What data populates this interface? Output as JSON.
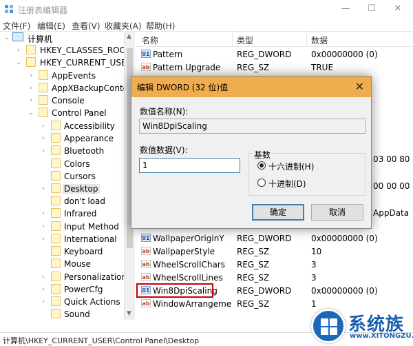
{
  "window": {
    "title": "注册表编辑器",
    "minimize": "—",
    "maximize": "☐",
    "close": "✕"
  },
  "menu": [
    "文件(F)",
    "编辑(E)",
    "查看(V)",
    "收藏夹(A)",
    "帮助(H)"
  ],
  "tree": {
    "root": "计算机",
    "items": [
      {
        "label": "HKEY_CLASSES_ROOT",
        "expander": "›"
      },
      {
        "label": "HKEY_CURRENT_USER",
        "expander": "⌄"
      },
      {
        "label": "AppEvents",
        "expander": "›"
      },
      {
        "label": "AppXBackupConter",
        "expander": "›"
      },
      {
        "label": "Console",
        "expander": "›"
      },
      {
        "label": "Control Panel",
        "expander": "⌄"
      },
      {
        "label": "Accessibility",
        "expander": "›"
      },
      {
        "label": "Appearance",
        "expander": "›"
      },
      {
        "label": "Bluetooth",
        "expander": "›"
      },
      {
        "label": "Colors",
        "expander": ""
      },
      {
        "label": "Cursors",
        "expander": ""
      },
      {
        "label": "Desktop",
        "expander": "›"
      },
      {
        "label": "don't load",
        "expander": ""
      },
      {
        "label": "Infrared",
        "expander": "›"
      },
      {
        "label": "Input Method",
        "expander": "›"
      },
      {
        "label": "International",
        "expander": "›"
      },
      {
        "label": "Keyboard",
        "expander": ""
      },
      {
        "label": "Mouse",
        "expander": ""
      },
      {
        "label": "Personalization",
        "expander": "›"
      },
      {
        "label": "PowerCfg",
        "expander": "›"
      },
      {
        "label": "Quick Actions",
        "expander": "›"
      },
      {
        "label": "Sound",
        "expander": ""
      }
    ]
  },
  "list": {
    "headers": {
      "name": "名称",
      "type": "类型",
      "data": "数据"
    },
    "rows": [
      {
        "icon": "dword",
        "name": "Pattern",
        "type": "REG_DWORD",
        "data": "0x00000000 (0)"
      },
      {
        "icon": "sz",
        "name": "Pattern Upgrade",
        "type": "REG_SZ",
        "data": "TRUE"
      },
      {
        "icon": "dword",
        "name": "WallpaperOriginY",
        "type": "REG_DWORD",
        "data": "0x00000000 (0)"
      },
      {
        "icon": "sz",
        "name": "WallpaperStyle",
        "type": "REG_SZ",
        "data": "10"
      },
      {
        "icon": "sz",
        "name": "WheelScrollChars",
        "type": "REG_SZ",
        "data": "3"
      },
      {
        "icon": "sz",
        "name": "WheelScrollLines",
        "type": "REG_SZ",
        "data": "3"
      },
      {
        "icon": "dword",
        "name": "Win8DpiScaling",
        "type": "REG_DWORD",
        "data": "0x00000000 (0)"
      },
      {
        "icon": "sz",
        "name": "WindowArrangeme...",
        "type": "REG_SZ",
        "data": "1"
      }
    ],
    "peek": {
      "a": "03 00 80",
      "b": "00 00 00",
      "c": "AppData"
    }
  },
  "dialog": {
    "title": "编辑 DWORD (32 位)值",
    "close": "✕",
    "name_label": "数值名称(N):",
    "name_value": "Win8DpiScaling",
    "data_label": "数值数据(V):",
    "data_value": "1",
    "base_label": "基数",
    "hex_label": "十六进制(H)",
    "dec_label": "十进制(D)",
    "selected_base": "hex",
    "ok": "确定",
    "cancel": "取消"
  },
  "status": "计算机\\HKEY_CURRENT_USER\\Control Panel\\Desktop",
  "logo": {
    "cn": "系统族",
    "url": "www.XITONGZU.COM"
  },
  "colors": {
    "dialog_title": "#f0ad4e",
    "highlight": "#c40000",
    "logo": "#1c5fae"
  }
}
